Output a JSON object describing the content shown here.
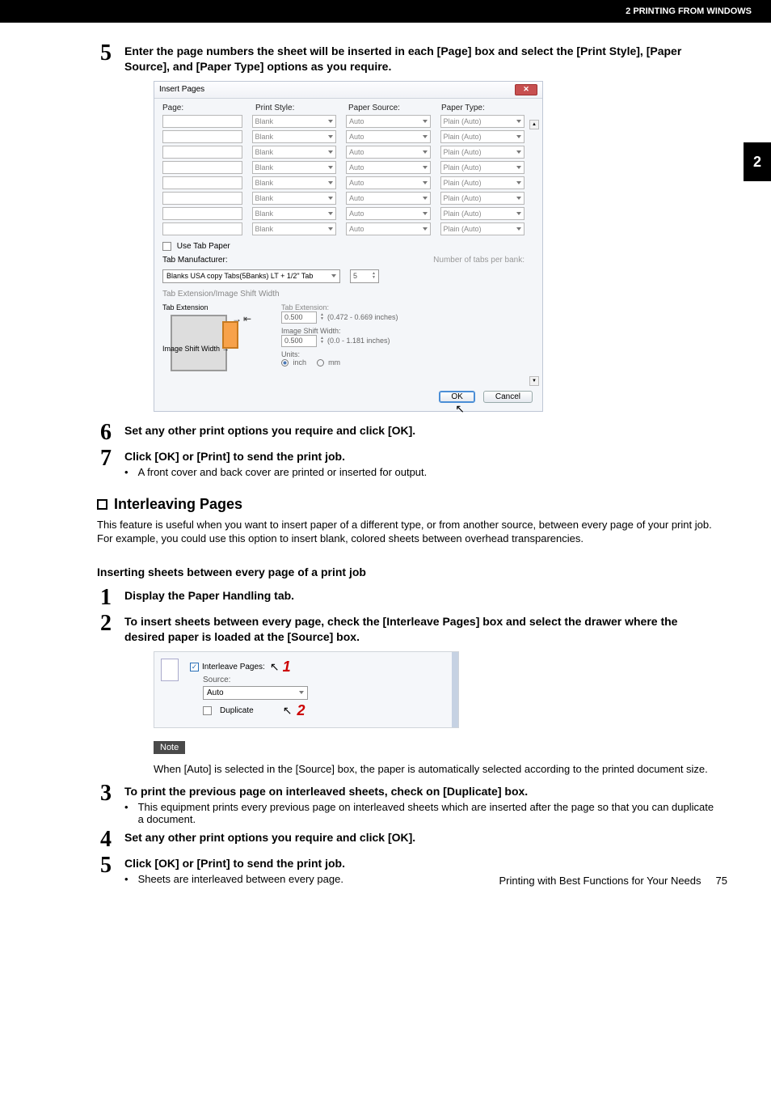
{
  "pageHeader": "2 PRINTING FROM WINDOWS",
  "sideTab": "2",
  "step5": {
    "num": "5",
    "title": "Enter the page numbers the sheet will be inserted in each [Page] box and select the [Print Style], [Paper Source], and [Paper Type] options as you require."
  },
  "dialog1": {
    "title": "Insert Pages",
    "closeX": "✕",
    "headers": {
      "page": "Page:",
      "style": "Print Style:",
      "source": "Paper Source:",
      "type": "Paper Type:"
    },
    "row": {
      "style": "Blank",
      "source": "Auto",
      "type": "Plain (Auto)"
    },
    "useTab": "Use Tab Paper",
    "tabManuf": "Tab Manufacturer:",
    "tabsPerBank": "Number of tabs per bank:",
    "manufValue": "Blanks USA copy Tabs(5Banks) LT + 1/2\"  Tab",
    "bankVal": "5",
    "tabExtImgShift": "Tab Extension/Image Shift Width",
    "tabExtLbl": "Tab Extension",
    "imgShiftLbl": "Image Shift Width",
    "tabExtension": {
      "lbl": "Tab Extension:",
      "val": "0.500",
      "range": "(0.472 - 0.669 inches)"
    },
    "imgShift": {
      "lbl": "Image Shift Width:",
      "val": "0.500",
      "range": "(0.0 - 1.181 inches)"
    },
    "unitsLbl": "Units:",
    "unitInch": "inch",
    "unitMm": "mm",
    "ok": "OK",
    "cancel": "Cancel"
  },
  "step6": {
    "num": "6",
    "title": "Set any other print options you require and click [OK]."
  },
  "step7": {
    "num": "7",
    "title": "Click [OK] or [Print] to send the print job.",
    "bullet": "A front cover and back cover are printed or inserted for output."
  },
  "interleaving": {
    "heading": "Interleaving Pages",
    "para": "This feature is useful when you want to insert paper of a different type, or from another source, between every page of your print job.  For example, you could use this option to insert blank, colored sheets between overhead transparencies.",
    "subheading": "Inserting sheets between every page of a print job"
  },
  "istep1": {
    "num": "1",
    "title": "Display the Paper Handling tab."
  },
  "istep2": {
    "num": "2",
    "title": "To insert sheets between every page, check the [Interleave Pages] box and select the drawer where the desired paper is loaded at the [Source] box."
  },
  "miniPanel": {
    "interleave": "Interleave Pages:",
    "source": "Source:",
    "auto": "Auto",
    "duplicate": "Duplicate",
    "red1": "1",
    "red2": "2"
  },
  "note": {
    "badge": "Note",
    "text": "When [Auto] is selected in the [Source] box, the paper is automatically selected according to the printed document size."
  },
  "istep3": {
    "num": "3",
    "title": "To print the previous page on interleaved sheets, check on [Duplicate] box.",
    "bullet": "This equipment prints every previous page on interleaved sheets which are inserted after the page so that you can duplicate a document."
  },
  "istep4": {
    "num": "4",
    "title": "Set any other print options you require and click [OK]."
  },
  "istep5": {
    "num": "5",
    "title": "Click [OK] or [Print] to send the print job.",
    "bullet": "Sheets are interleaved between every page."
  },
  "footer": {
    "text": "Printing with Best Functions for Your Needs",
    "page": "75"
  }
}
